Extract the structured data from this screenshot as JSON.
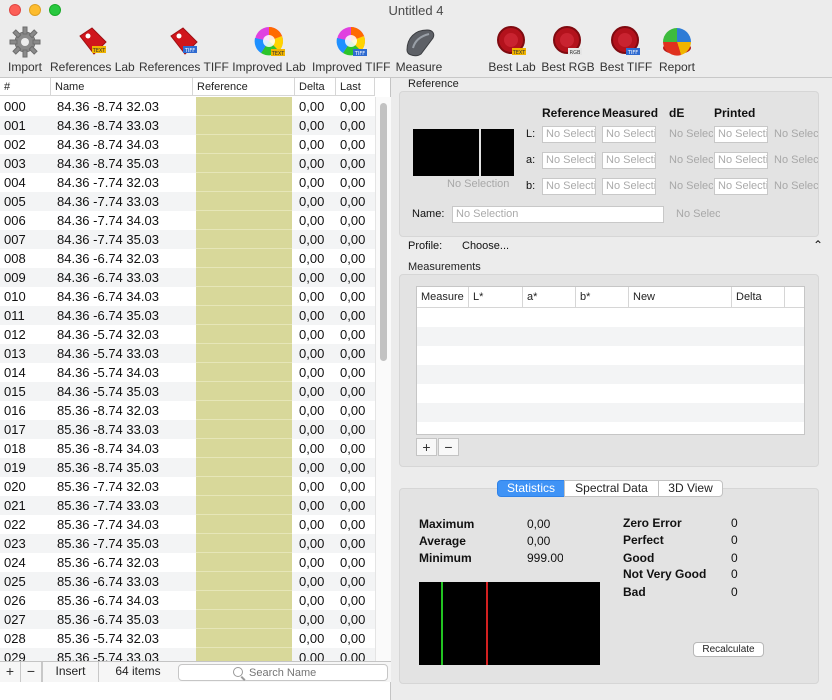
{
  "window": {
    "title": "Untitled 4"
  },
  "toolbar": {
    "items": [
      {
        "label": "Import",
        "icon": "gear-icon"
      },
      {
        "label": "References Lab",
        "icon": "tag-text-icon"
      },
      {
        "label": "References TIFF",
        "icon": "tag-tiff-icon"
      },
      {
        "label": "Improved Lab",
        "icon": "color-wheel-text-icon"
      },
      {
        "label": "Improved TIFF",
        "icon": "color-wheel-tiff-icon"
      },
      {
        "label": "Measure",
        "icon": "spectrophotometer-icon"
      },
      {
        "label": "Best Lab",
        "icon": "seal-text-icon"
      },
      {
        "label": "Best RGB",
        "icon": "seal-rgb-icon"
      },
      {
        "label": "Best TIFF",
        "icon": "seal-tiff-icon"
      },
      {
        "label": "Report",
        "icon": "pie-chart-icon"
      }
    ]
  },
  "list": {
    "columns": [
      "#",
      "Name",
      "Reference",
      "Delta",
      "Last"
    ],
    "swatch_color": "#d8d89a",
    "rows": [
      {
        "num": "000",
        "name": "84.36 -8.74 32.03",
        "delta": "0,00",
        "last": "0,00"
      },
      {
        "num": "001",
        "name": "84.36 -8.74 33.03",
        "delta": "0,00",
        "last": "0,00"
      },
      {
        "num": "002",
        "name": "84.36 -8.74 34.03",
        "delta": "0,00",
        "last": "0,00"
      },
      {
        "num": "003",
        "name": "84.36 -8.74 35.03",
        "delta": "0,00",
        "last": "0,00"
      },
      {
        "num": "004",
        "name": "84.36 -7.74 32.03",
        "delta": "0,00",
        "last": "0,00"
      },
      {
        "num": "005",
        "name": "84.36 -7.74 33.03",
        "delta": "0,00",
        "last": "0,00"
      },
      {
        "num": "006",
        "name": "84.36 -7.74 34.03",
        "delta": "0,00",
        "last": "0,00"
      },
      {
        "num": "007",
        "name": "84.36 -7.74 35.03",
        "delta": "0,00",
        "last": "0,00"
      },
      {
        "num": "008",
        "name": "84.36 -6.74 32.03",
        "delta": "0,00",
        "last": "0,00"
      },
      {
        "num": "009",
        "name": "84.36 -6.74 33.03",
        "delta": "0,00",
        "last": "0,00"
      },
      {
        "num": "010",
        "name": "84.36 -6.74 34.03",
        "delta": "0,00",
        "last": "0,00"
      },
      {
        "num": "011",
        "name": "84.36 -6.74 35.03",
        "delta": "0,00",
        "last": "0,00"
      },
      {
        "num": "012",
        "name": "84.36 -5.74 32.03",
        "delta": "0,00",
        "last": "0,00"
      },
      {
        "num": "013",
        "name": "84.36 -5.74 33.03",
        "delta": "0,00",
        "last": "0,00"
      },
      {
        "num": "014",
        "name": "84.36 -5.74 34.03",
        "delta": "0,00",
        "last": "0,00"
      },
      {
        "num": "015",
        "name": "84.36 -5.74 35.03",
        "delta": "0,00",
        "last": "0,00"
      },
      {
        "num": "016",
        "name": "85.36 -8.74 32.03",
        "delta": "0,00",
        "last": "0,00"
      },
      {
        "num": "017",
        "name": "85.36 -8.74 33.03",
        "delta": "0,00",
        "last": "0,00"
      },
      {
        "num": "018",
        "name": "85.36 -8.74 34.03",
        "delta": "0,00",
        "last": "0,00"
      },
      {
        "num": "019",
        "name": "85.36 -8.74 35.03",
        "delta": "0,00",
        "last": "0,00"
      },
      {
        "num": "020",
        "name": "85.36 -7.74 32.03",
        "delta": "0,00",
        "last": "0,00"
      },
      {
        "num": "021",
        "name": "85.36 -7.74 33.03",
        "delta": "0,00",
        "last": "0,00"
      },
      {
        "num": "022",
        "name": "85.36 -7.74 34.03",
        "delta": "0,00",
        "last": "0,00"
      },
      {
        "num": "023",
        "name": "85.36 -7.74 35.03",
        "delta": "0,00",
        "last": "0,00"
      },
      {
        "num": "024",
        "name": "85.36 -6.74 32.03",
        "delta": "0,00",
        "last": "0,00"
      },
      {
        "num": "025",
        "name": "85.36 -6.74 33.03",
        "delta": "0,00",
        "last": "0,00"
      },
      {
        "num": "026",
        "name": "85.36 -6.74 34.03",
        "delta": "0,00",
        "last": "0,00"
      },
      {
        "num": "027",
        "name": "85.36 -6.74 35.03",
        "delta": "0,00",
        "last": "0,00"
      },
      {
        "num": "028",
        "name": "85.36 -5.74 32.03",
        "delta": "0,00",
        "last": "0,00"
      },
      {
        "num": "029",
        "name": "85.36 -5.74 33.03",
        "delta": "0,00",
        "last": "0,00"
      }
    ]
  },
  "bottombar": {
    "add": "+",
    "remove": "−",
    "insert": "Insert",
    "count": "64 items",
    "search_placeholder": "Search Name"
  },
  "reference": {
    "title": "Reference",
    "no_selection": "No Selection",
    "headers": {
      "reference": "Reference",
      "measured": "Measured",
      "de": "dE",
      "printed": "Printed"
    },
    "rows": [
      "L:",
      "a:",
      "b:"
    ],
    "field_placeholder": "No Selection",
    "gray_value": "No Selection",
    "name_label": "Name:",
    "name_placeholder": "No Selection",
    "name_gray": "No Selection"
  },
  "profile": {
    "label": "Profile:",
    "value": "Choose..."
  },
  "measurements": {
    "title": "Measurements",
    "columns": [
      "Measure",
      "L*",
      "a*",
      "b*",
      "New",
      "Delta"
    ],
    "add": "+",
    "remove": "−"
  },
  "tabs": {
    "items": [
      "Statistics",
      "Spectral Data",
      "3D View"
    ],
    "active": "Statistics"
  },
  "stats": {
    "left": [
      {
        "label": "Maximum",
        "value": "0,00"
      },
      {
        "label": "Average",
        "value": "0,00"
      },
      {
        "label": "Minimum",
        "value": "999.00"
      }
    ],
    "right": [
      {
        "label": "Zero Error",
        "value": "0"
      },
      {
        "label": "Perfect",
        "value": "0"
      },
      {
        "label": "Good",
        "value": "0"
      },
      {
        "label": "Not Very Good",
        "value": "0"
      },
      {
        "label": "Bad",
        "value": "0"
      }
    ],
    "histogram_colors": {
      "green": "#22c322",
      "red": "#d22020"
    },
    "recalculate": "Recalculate"
  }
}
